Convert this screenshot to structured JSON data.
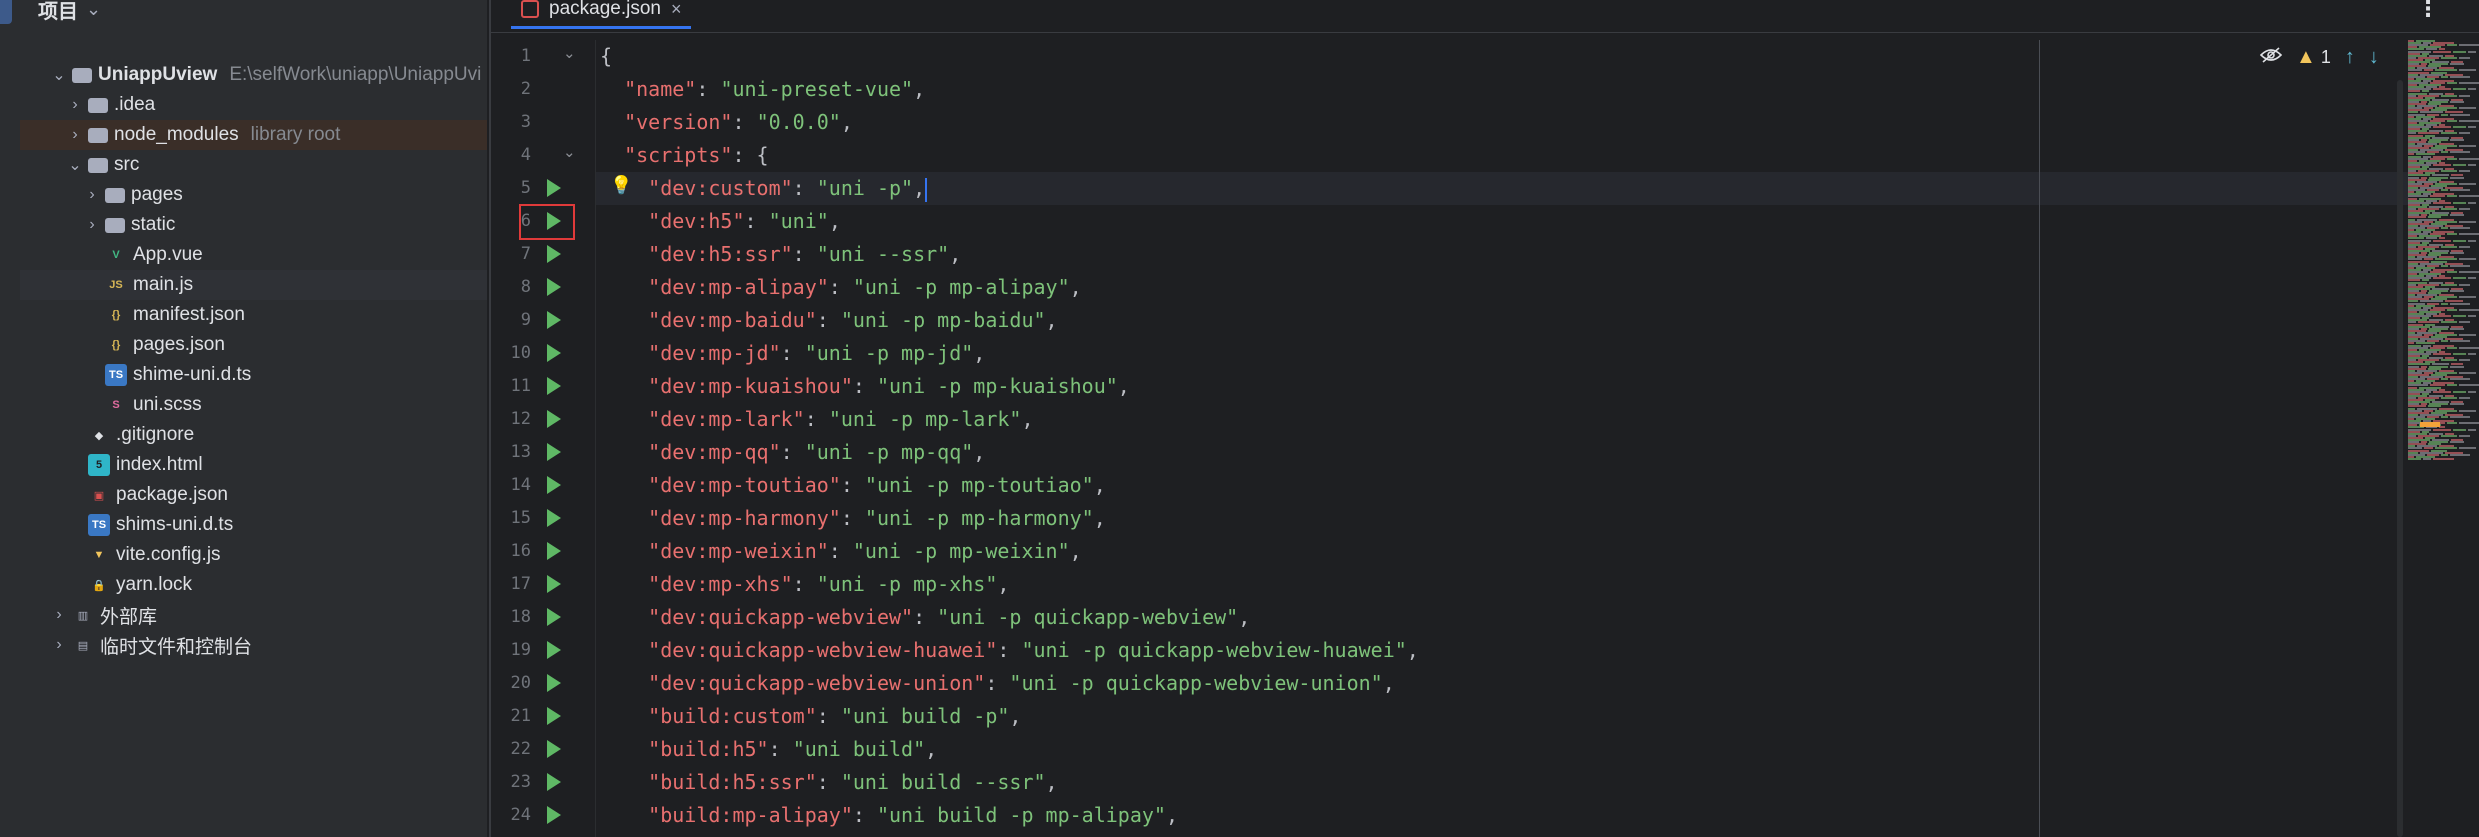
{
  "project_panel": {
    "title": "项目",
    "rows": [
      {
        "label": "UniappUview",
        "hint": "E:\\selfWork\\uniapp\\UniappUvi",
        "icon": "folder-icon",
        "expanded": true
      },
      {
        "label": ".idea",
        "hint": "",
        "icon": "folder-icon",
        "expanded": false
      },
      {
        "label": "node_modules",
        "hint": "library root",
        "icon": "folder-icon",
        "expanded": false
      },
      {
        "label": "src",
        "hint": "",
        "icon": "folder-icon",
        "expanded": true
      },
      {
        "label": "pages",
        "hint": "",
        "icon": "folder-icon",
        "expanded": false
      },
      {
        "label": "static",
        "hint": "",
        "icon": "folder-icon",
        "expanded": false
      },
      {
        "label": "App.vue",
        "hint": "",
        "icon": "vue-file-icon"
      },
      {
        "label": "main.js",
        "hint": "",
        "icon": "js-file-icon"
      },
      {
        "label": "manifest.json",
        "hint": "",
        "icon": "json-file-icon"
      },
      {
        "label": "pages.json",
        "hint": "",
        "icon": "json-file-icon"
      },
      {
        "label": "shime-uni.d.ts",
        "hint": "",
        "icon": "ts-file-icon"
      },
      {
        "label": "uni.scss",
        "hint": "",
        "icon": "scss-file-icon"
      },
      {
        "label": ".gitignore",
        "hint": "",
        "icon": "git-icon"
      },
      {
        "label": "index.html",
        "hint": "",
        "icon": "html-file-icon"
      },
      {
        "label": "package.json",
        "hint": "",
        "icon": "npm-file-icon"
      },
      {
        "label": "shims-uni.d.ts",
        "hint": "",
        "icon": "ts-file-icon"
      },
      {
        "label": "vite.config.js",
        "hint": "",
        "icon": "vite-file-icon"
      },
      {
        "label": "yarn.lock",
        "hint": "",
        "icon": "lock-icon"
      },
      {
        "label": "外部库",
        "hint": "",
        "icon": "library-icon",
        "expanded": false
      },
      {
        "label": "临时文件和控制台",
        "hint": "",
        "icon": "scratch-icon",
        "expanded": false
      }
    ]
  },
  "editor": {
    "tab_label": "package.json",
    "tab_close": "×",
    "warnings_count": "1",
    "lines": [
      {
        "n": "1",
        "code": "{"
      },
      {
        "n": "2",
        "code": "  \"name\": \"uni-preset-vue\","
      },
      {
        "n": "3",
        "code": "  \"version\": \"0.0.0\","
      },
      {
        "n": "4",
        "code": "  \"scripts\": {"
      },
      {
        "n": "5",
        "code": "    \"dev:custom\": \"uni -p\","
      },
      {
        "n": "6",
        "code": "    \"dev:h5\": \"uni\","
      },
      {
        "n": "7",
        "code": "    \"dev:h5:ssr\": \"uni --ssr\","
      },
      {
        "n": "8",
        "code": "    \"dev:mp-alipay\": \"uni -p mp-alipay\","
      },
      {
        "n": "9",
        "code": "    \"dev:mp-baidu\": \"uni -p mp-baidu\","
      },
      {
        "n": "10",
        "code": "    \"dev:mp-jd\": \"uni -p mp-jd\","
      },
      {
        "n": "11",
        "code": "    \"dev:mp-kuaishou\": \"uni -p mp-kuaishou\","
      },
      {
        "n": "12",
        "code": "    \"dev:mp-lark\": \"uni -p mp-lark\","
      },
      {
        "n": "13",
        "code": "    \"dev:mp-qq\": \"uni -p mp-qq\","
      },
      {
        "n": "14",
        "code": "    \"dev:mp-toutiao\": \"uni -p mp-toutiao\","
      },
      {
        "n": "15",
        "code": "    \"dev:mp-harmony\": \"uni -p mp-harmony\","
      },
      {
        "n": "16",
        "code": "    \"dev:mp-weixin\": \"uni -p mp-weixin\","
      },
      {
        "n": "17",
        "code": "    \"dev:mp-xhs\": \"uni -p mp-xhs\","
      },
      {
        "n": "18",
        "code": "    \"dev:quickapp-webview\": \"uni -p quickapp-webview\","
      },
      {
        "n": "19",
        "code": "    \"dev:quickapp-webview-huawei\": \"uni -p quickapp-webview-huawei\","
      },
      {
        "n": "20",
        "code": "    \"dev:quickapp-webview-union\": \"uni -p quickapp-webview-union\","
      },
      {
        "n": "21",
        "code": "    \"build:custom\": \"uni build -p\","
      },
      {
        "n": "22",
        "code": "    \"build:h5\": \"uni build\","
      },
      {
        "n": "23",
        "code": "    \"build:h5:ssr\": \"uni build --ssr\","
      },
      {
        "n": "24",
        "code": "    \"build:mp-alipay\": \"uni build -p mp-alipay\","
      }
    ]
  }
}
